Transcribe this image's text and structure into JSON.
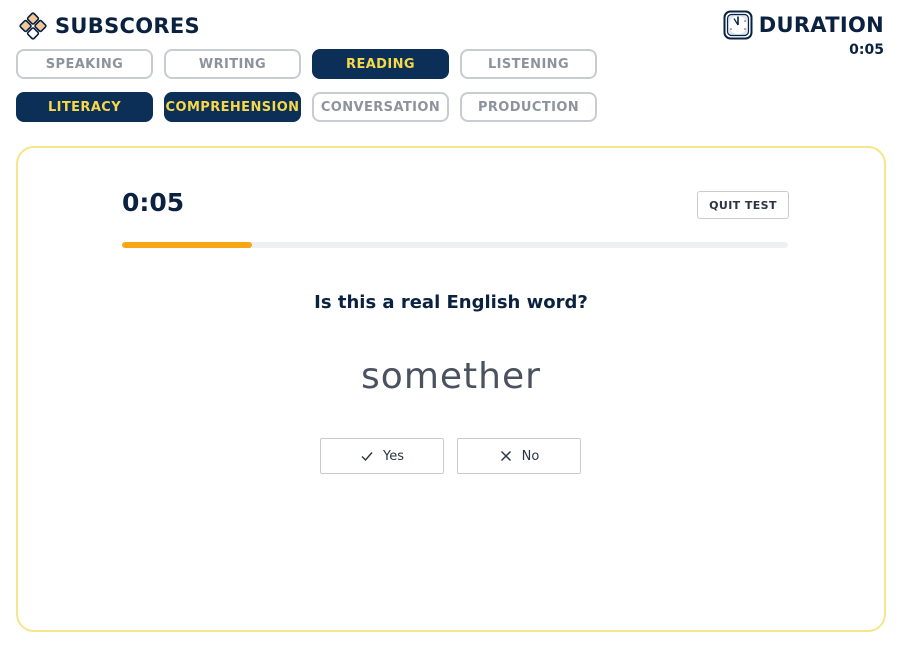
{
  "header": {
    "title": "SUBSCORES",
    "logo_icon": "diamond-grid-icon"
  },
  "duration": {
    "title": "DURATION",
    "value": "0:05",
    "icon": "clock-icon"
  },
  "skill_tabs": [
    {
      "label": "SPEAKING",
      "active": false
    },
    {
      "label": "WRITING",
      "active": false
    },
    {
      "label": "READING",
      "active": true
    },
    {
      "label": "LISTENING",
      "active": false
    }
  ],
  "subscore_tabs": [
    {
      "label": "LITERACY",
      "active": true
    },
    {
      "label": "COMPREHENSION",
      "active": true
    },
    {
      "label": "CONVERSATION",
      "active": false
    },
    {
      "label": "PRODUCTION",
      "active": false
    }
  ],
  "test": {
    "timer": "0:05",
    "quit_label": "QUIT TEST",
    "progress": 0.195,
    "question": "Is this a real English word?",
    "word": "somether",
    "yes_label": "Yes",
    "no_label": "No"
  },
  "colors": {
    "navy": "#0b2f57",
    "accent_yellow": "#f7d84a",
    "progress_orange": "#f9a615",
    "card_border": "#f6e58a"
  }
}
